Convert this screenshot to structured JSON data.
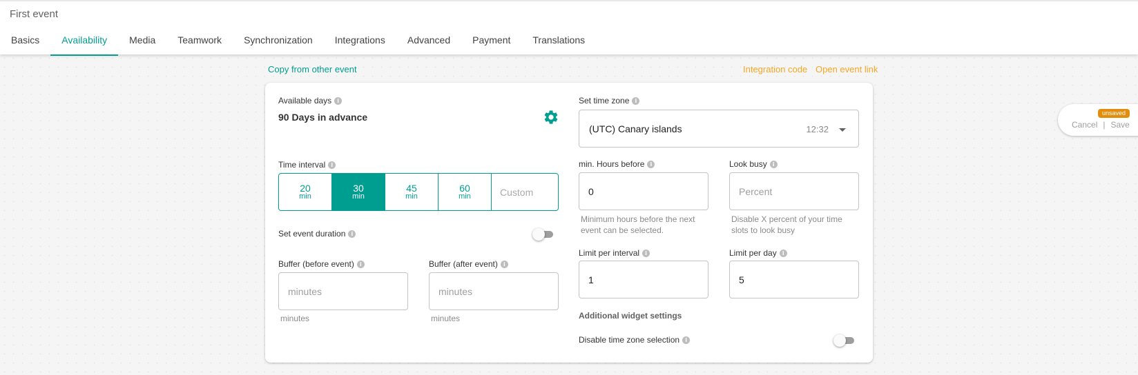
{
  "header": {
    "title": "First event",
    "tabs": [
      {
        "label": "Basics",
        "active": false
      },
      {
        "label": "Availability",
        "active": true
      },
      {
        "label": "Media",
        "active": false
      },
      {
        "label": "Teamwork",
        "active": false
      },
      {
        "label": "Synchronization",
        "active": false
      },
      {
        "label": "Integrations",
        "active": false
      },
      {
        "label": "Advanced",
        "active": false
      },
      {
        "label": "Payment",
        "active": false
      },
      {
        "label": "Translations",
        "active": false
      }
    ]
  },
  "links": {
    "copy_from_other": "Copy from other event",
    "integration_code": "Integration code",
    "open_event_link": "Open event link"
  },
  "colors": {
    "accent": "#009e91",
    "link_orange": "#f5a623",
    "badge_orange": "#e08e0b"
  },
  "availability": {
    "available_days_label": "Available days",
    "available_days_value": "90 Days in advance",
    "settings_icon": "gear-icon",
    "time_interval_label": "Time interval",
    "intervals": [
      {
        "value": "20",
        "unit": "min",
        "selected": false
      },
      {
        "value": "30",
        "unit": "min",
        "selected": true
      },
      {
        "value": "45",
        "unit": "min",
        "selected": false
      },
      {
        "value": "60",
        "unit": "min",
        "selected": false
      }
    ],
    "custom_placeholder": "Custom",
    "event_duration_label": "Set event duration",
    "event_duration_enabled": false,
    "buffer_before": {
      "label": "Buffer (before event)",
      "value": "",
      "placeholder": "minutes",
      "hint": "minutes"
    },
    "buffer_after": {
      "label": "Buffer (after event)",
      "value": "",
      "placeholder": "minutes",
      "hint": "minutes"
    }
  },
  "timezone": {
    "label": "Set time zone",
    "selected": "(UTC) Canary islands",
    "current_time": "12:32"
  },
  "limits": {
    "min_hours_before": {
      "label": "min. Hours before",
      "value": "0",
      "hint": "Minimum hours before the next event can be selected."
    },
    "look_busy": {
      "label": "Look busy",
      "value": "",
      "placeholder": "Percent",
      "hint": "Disable X percent of your time slots to look busy"
    },
    "limit_per_interval": {
      "label": "Limit per interval",
      "value": "1"
    },
    "limit_per_day": {
      "label": "Limit per day",
      "value": "5"
    }
  },
  "widget": {
    "section_title": "Additional widget settings",
    "disable_tz_label": "Disable time zone selection",
    "disable_tz_enabled": false
  },
  "save_panel": {
    "badge": "unsaved",
    "cancel_label": "Cancel",
    "separator": "|",
    "save_label": "Save"
  }
}
